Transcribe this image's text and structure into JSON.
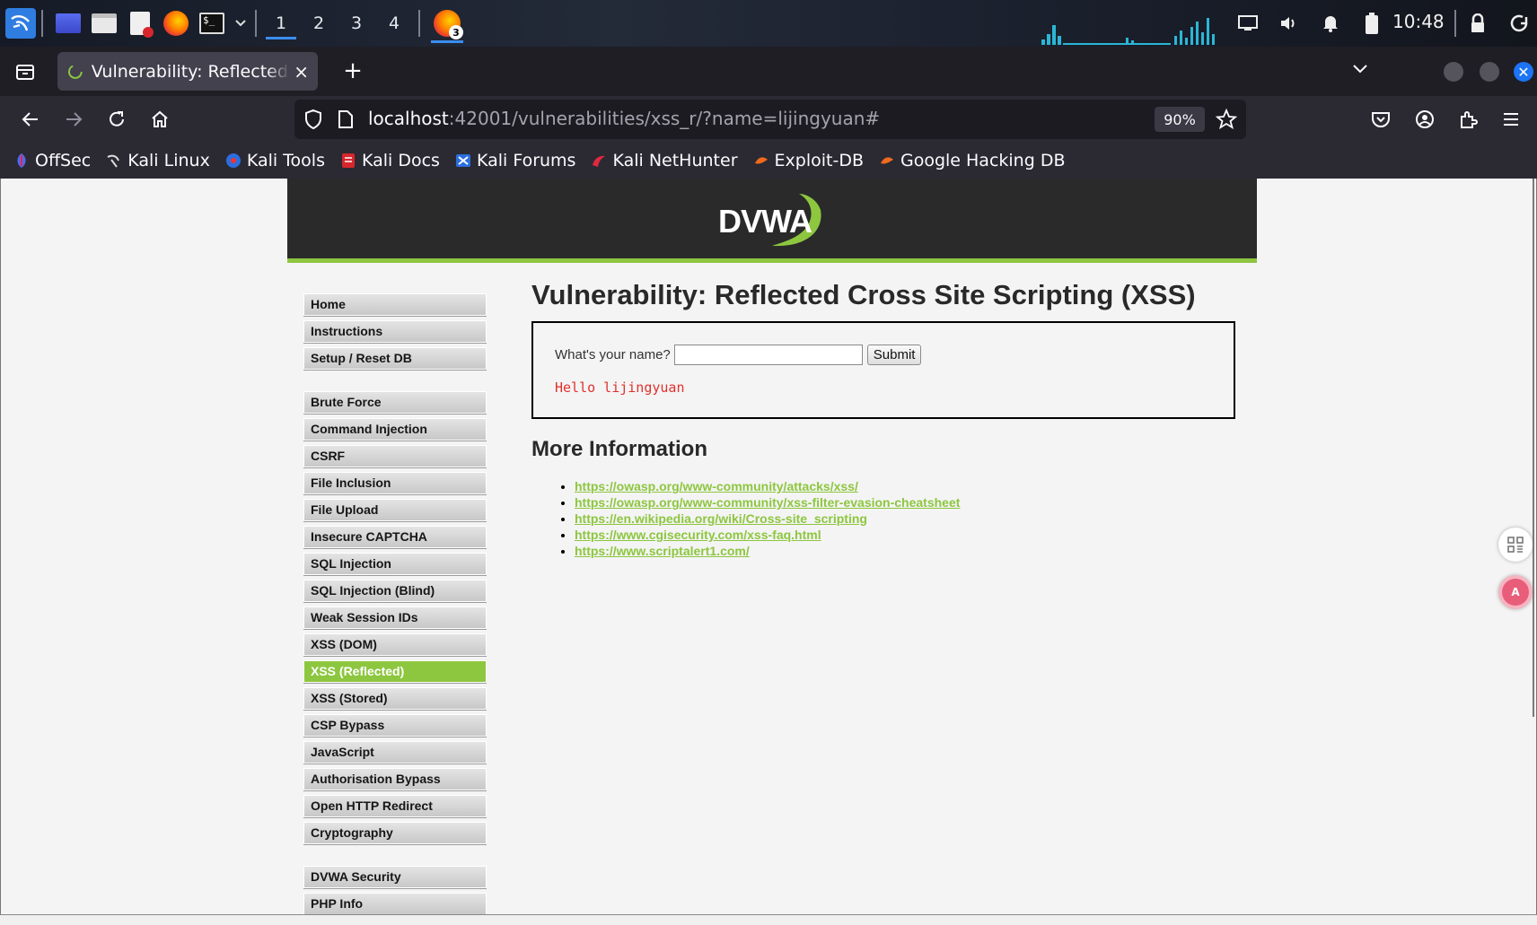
{
  "taskbar": {
    "workspaces": [
      "1",
      "2",
      "3",
      "4"
    ],
    "active_workspace": "1",
    "firefox_window_count": "3",
    "clock": "10:48",
    "icons": [
      "kali-menu-icon",
      "desktop-icon",
      "file-manager-icon",
      "text-editor-icon",
      "firefox-icon",
      "terminal-icon",
      "chevron-down-icon"
    ],
    "tray_icons": [
      "display-icon",
      "volume-icon",
      "bell-icon",
      "battery-icon",
      "lock-icon",
      "power-icon"
    ]
  },
  "browser": {
    "tab_title": "Vulnerability: Reflected Cross Site Scripting (XSS)",
    "url_host": "localhost",
    "url_rest": ":42001/vulnerabilities/xss_r/?name=lijingyuan#",
    "zoom": "90%",
    "bookmarks": [
      "OffSec",
      "Kali Linux",
      "Kali Tools",
      "Kali Docs",
      "Kali Forums",
      "Kali NetHunter",
      "Exploit-DB",
      "Google Hacking DB"
    ]
  },
  "dvwa": {
    "logo": "DVWA",
    "menu_group1": [
      "Home",
      "Instructions",
      "Setup / Reset DB"
    ],
    "menu_group2": [
      "Brute Force",
      "Command Injection",
      "CSRF",
      "File Inclusion",
      "File Upload",
      "Insecure CAPTCHA",
      "SQL Injection",
      "SQL Injection (Blind)",
      "Weak Session IDs",
      "XSS (DOM)",
      "XSS (Reflected)",
      "XSS (Stored)",
      "CSP Bypass",
      "JavaScript",
      "Authorisation Bypass",
      "Open HTTP Redirect",
      "Cryptography"
    ],
    "menu_group3": [
      "DVWA Security",
      "PHP Info"
    ],
    "selected_menu": "XSS (Reflected)",
    "page_title": "Vulnerability: Reflected Cross Site Scripting (XSS)",
    "form_label": "What's your name?",
    "input_value": "",
    "submit_label": "Submit",
    "result_text": "Hello lijingyuan",
    "more_info_title": "More Information",
    "links": [
      "https://owasp.org/www-community/attacks/xss/",
      "https://owasp.org/www-community/xss-filter-evasion-cheatsheet",
      "https://en.wikipedia.org/wiki/Cross-site_scripting",
      "https://www.cgisecurity.com/xss-faq.html",
      "https://www.scriptalert1.com/"
    ]
  },
  "colors": {
    "dvwa_green": "#8dc63f",
    "result_red": "#e0312d",
    "accent_blue": "#3b8df0"
  }
}
